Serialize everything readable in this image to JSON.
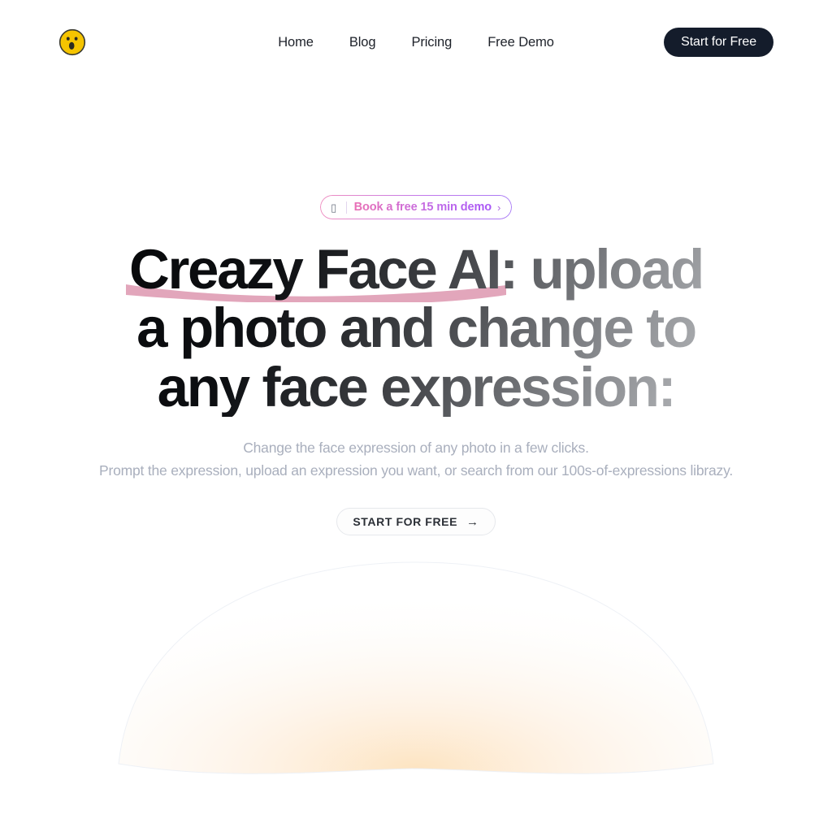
{
  "header": {
    "logo_icon": "surprised-face-emoji",
    "nav": [
      {
        "label": "Home"
      },
      {
        "label": "Blog"
      },
      {
        "label": "Pricing"
      },
      {
        "label": "Free Demo"
      }
    ],
    "cta_label": "Start for Free"
  },
  "hero": {
    "badge": {
      "glyph": "▯",
      "text": "Book a free 15 min demo",
      "chevron": "›",
      "gradient_start": "#e96fb5",
      "gradient_end": "#a855f7"
    },
    "headline": "Creazy Face AI: upload a photo and change to any face expression:",
    "highlight_phrase": "Creazy Face AI",
    "highlight_color": "#e0a8bd",
    "subtitle_line1": "Change the face expression of any photo in a few clicks.",
    "subtitle_line2": "Prompt the expression, upload an expression you want, or search from our 100s-of-expressions librazy.",
    "cta_label": "START FOR FREE",
    "cta_arrow": "→"
  },
  "decoration": {
    "dome_glow_color": "#fde4c4"
  }
}
